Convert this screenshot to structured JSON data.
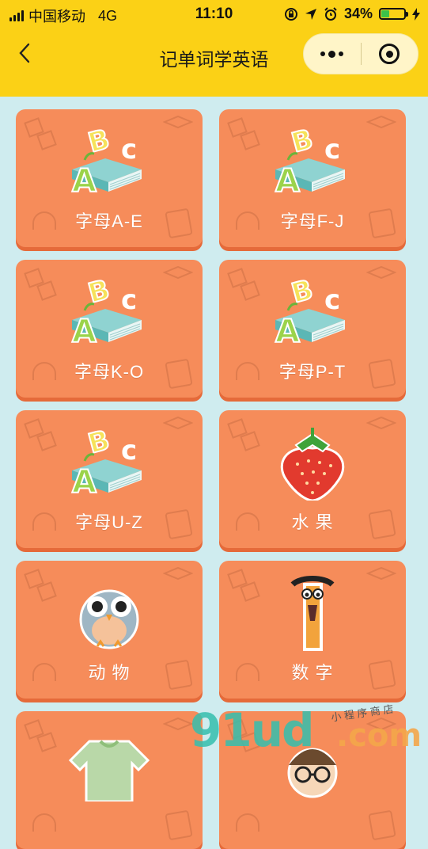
{
  "status_bar": {
    "carrier": "中国移动",
    "network": "4G",
    "time": "11:10",
    "battery_percent": "34%",
    "battery_level": 0.34,
    "icons": [
      "rotation-lock-icon",
      "location-arrow-icon",
      "alarm-icon",
      "charging-icon"
    ]
  },
  "nav": {
    "title": "记单词学英语",
    "back_icon": "chevron-left-icon",
    "more_icon": "more-dots-icon",
    "close_icon": "target-close-icon"
  },
  "colors": {
    "header": "#fbd116",
    "background": "#cfecef",
    "card": "#f68c5a",
    "card_shadow": "#e56a3a"
  },
  "cards": [
    {
      "label": "字母A-E",
      "icon": "abc-book-icon"
    },
    {
      "label": "字母F-J",
      "icon": "abc-book-icon"
    },
    {
      "label": "字母K-O",
      "icon": "abc-book-icon"
    },
    {
      "label": "字母P-T",
      "icon": "abc-book-icon"
    },
    {
      "label": "字母U-Z",
      "icon": "abc-book-icon"
    },
    {
      "label": "水 果",
      "icon": "strawberry-icon"
    },
    {
      "label": "动 物",
      "icon": "owl-icon"
    },
    {
      "label": "数 字",
      "icon": "number-one-icon"
    },
    {
      "label": "",
      "icon": "sweater-icon"
    },
    {
      "label": "",
      "icon": "person-glasses-icon"
    }
  ],
  "watermark": {
    "brand": "91ud",
    "tld": ".com",
    "note": "小 程 序 商 店"
  }
}
